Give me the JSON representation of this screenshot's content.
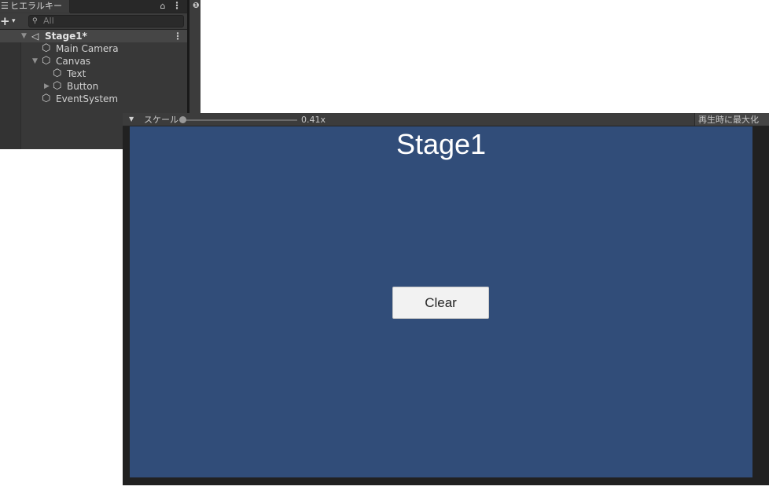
{
  "hierarchy": {
    "tab_label": "ヒエラルキー",
    "tab_icon": "list-icon",
    "lock_icon": "lock-icon",
    "menu_icon": "kebab-menu-icon",
    "add_label": "+",
    "add_caret": "▾",
    "search": {
      "placeholder": "All",
      "value": ""
    },
    "scene": {
      "name": "Stage1*",
      "expanded": true
    },
    "items": [
      {
        "label": "Main Camera",
        "depth": 1,
        "expandable": false
      },
      {
        "label": "Canvas",
        "depth": 1,
        "expandable": true,
        "expanded": true
      },
      {
        "label": "Text",
        "depth": 2,
        "expandable": false
      },
      {
        "label": "Button",
        "depth": 2,
        "expandable": true,
        "expanded": false
      },
      {
        "label": "EventSystem",
        "depth": 1,
        "expandable": false
      }
    ]
  },
  "inspector": {
    "info_icon": "info-icon"
  },
  "game_view": {
    "toolbar": {
      "scale_label": "スケール",
      "scale_value": "0.41x",
      "scale_fraction": 0.0,
      "maximize_label": "再生時に最大化"
    },
    "canvas": {
      "background": "#314d79",
      "title": "Stage1",
      "button_label": "Clear"
    }
  },
  "colors": {
    "editor_dark": "#383838",
    "toolbar": "#3c3c3c",
    "game_bg": "#212121",
    "canvas_blue": "#314d79",
    "button_bg": "#f2f2f2"
  }
}
